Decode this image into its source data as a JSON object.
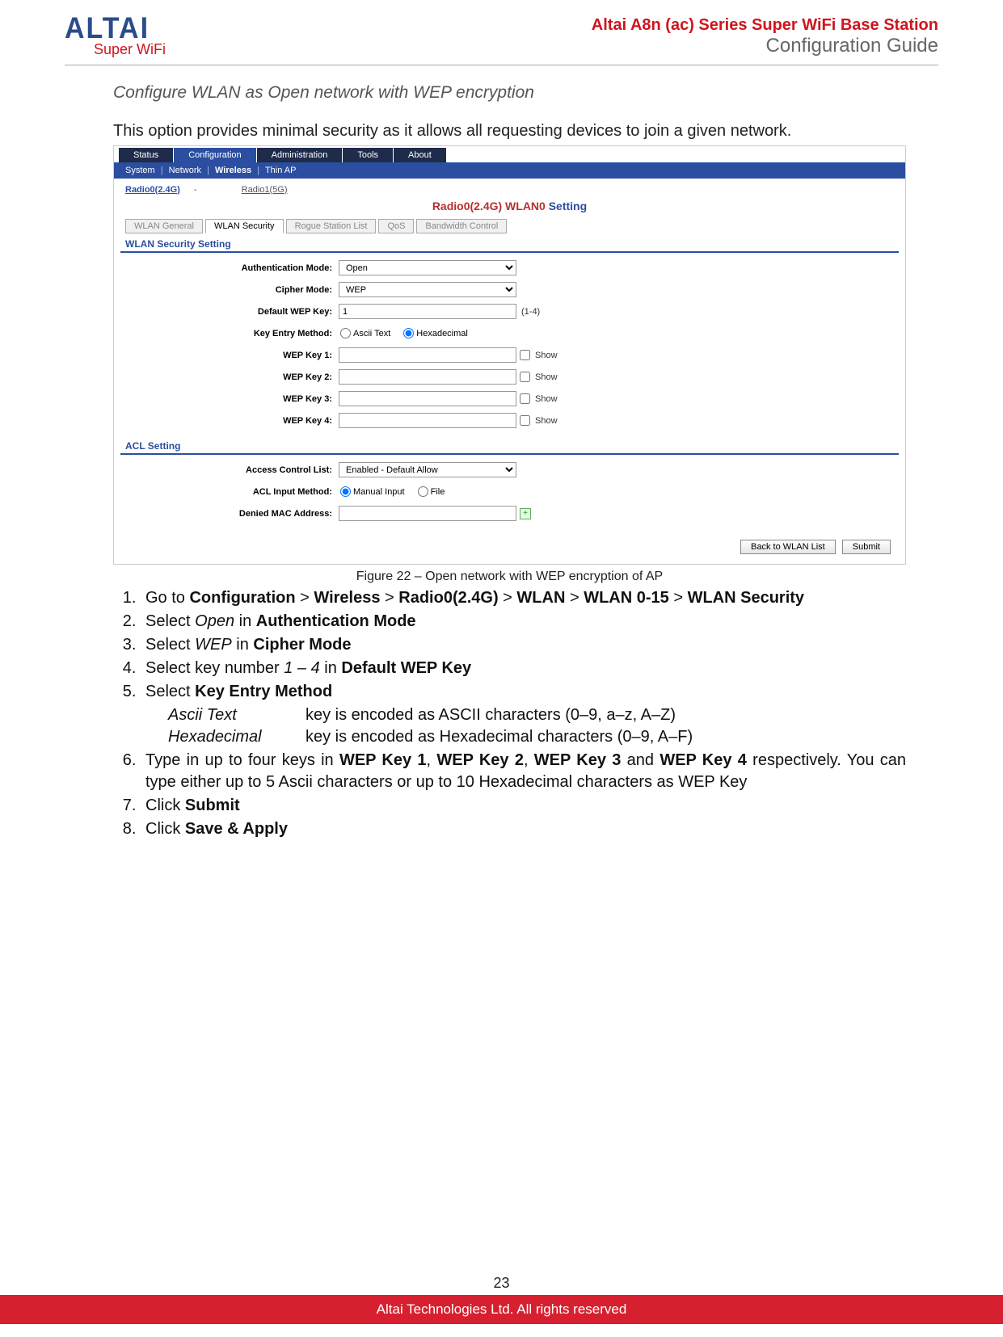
{
  "header": {
    "logo_main": "ALTAI",
    "logo_sub": "Super WiFi",
    "title_red": "Altai A8n (ac) Series Super WiFi Base Station",
    "title_gray": "Configuration Guide"
  },
  "section": {
    "title": "Configure WLAN as Open network with WEP encryption",
    "intro": "This option provides minimal security as it allows all requesting devices to join a given network."
  },
  "shot": {
    "tabs": [
      "Status",
      "Configuration",
      "Administration",
      "Tools",
      "About"
    ],
    "active_tab_index": 1,
    "subnav": [
      "System",
      "Network",
      "Wireless",
      "Thin AP"
    ],
    "subnav_active_index": 2,
    "radio_active": "Radio0(2.4G)",
    "radio_inactive": "Radio1(5G)",
    "setting_title_red": "Radio0(2.4G) WLAN0",
    "setting_title_blue": "Setting",
    "subtabs": [
      "WLAN General",
      "WLAN Security",
      "Rogue Station List",
      "QoS",
      "Bandwidth Control"
    ],
    "subtab_active_index": 1,
    "sec1": "WLAN Security Setting",
    "labels": {
      "auth_mode": "Authentication Mode:",
      "cipher": "Cipher Mode:",
      "def_key": "Default WEP Key:",
      "key_entry": "Key Entry Method:",
      "wep1": "WEP Key 1:",
      "wep2": "WEP Key 2:",
      "wep3": "WEP Key 3:",
      "wep4": "WEP Key 4:"
    },
    "auth_value": "Open",
    "cipher_value": "WEP",
    "def_key_value": "1",
    "def_key_hint": "(1-4)",
    "key_entry_ascii": "Ascii Text",
    "key_entry_hex": "Hexadecimal",
    "show": "Show",
    "sec2": "ACL Setting",
    "acl_labels": {
      "acl": "Access Control List:",
      "method": "ACL Input Method:",
      "denied": "Denied MAC Address:"
    },
    "acl_value": "Enabled - Default Allow",
    "acl_manual": "Manual Input",
    "acl_file": "File",
    "btn_back": "Back to WLAN List",
    "btn_submit": "Submit"
  },
  "caption": "Figure 22 – Open network with WEP encryption of AP",
  "steps": {
    "s1_a": "Go to ",
    "s1_conf": "Configuration",
    "s1_wireless": "Wireless",
    "s1_radio": "Radio0(2.4G)",
    "s1_wlan": "WLAN",
    "s1_wlan015": "WLAN 0-15",
    "s1_sec": "WLAN Security",
    "s2_a": "Select ",
    "s2_open": "Open",
    "s2_b": " in ",
    "s2_auth": "Authentication Mode",
    "s3_a": "Select ",
    "s3_wep": "WEP",
    "s3_b": " in ",
    "s3_cipher": "Cipher Mode",
    "s4_a": "Select key number ",
    "s4_num": "1 – 4",
    "s4_b": " in ",
    "s4_def": "Default WEP Key",
    "s5_a": "Select ",
    "s5_kem": "Key Entry Method",
    "s5_ascii_k": "Ascii Text",
    "s5_ascii_v": "key is encoded as ASCII characters (0–9, a–z, A–Z)",
    "s5_hex_k": "Hexadecimal",
    "s5_hex_v": "key is encoded as Hexadecimal characters (0–9, A–F)",
    "s6_a": "Type in up to four keys in ",
    "s6_k1": "WEP Key 1",
    "s6_k2": "WEP Key 2",
    "s6_k3": "WEP Key 3",
    "s6_and": " and ",
    "s6_k4": "WEP Key 4",
    "s6_b": " respectively. You can type either up to 5 Ascii characters or up to 10 Hexadecimal characters as WEP Key",
    "s7_a": "Click ",
    "s7_submit": "Submit",
    "s8_a": "Click ",
    "s8_save": "Save & Apply"
  },
  "footer": {
    "page": "23",
    "copyright": "Altai Technologies Ltd. All rights reserved"
  }
}
